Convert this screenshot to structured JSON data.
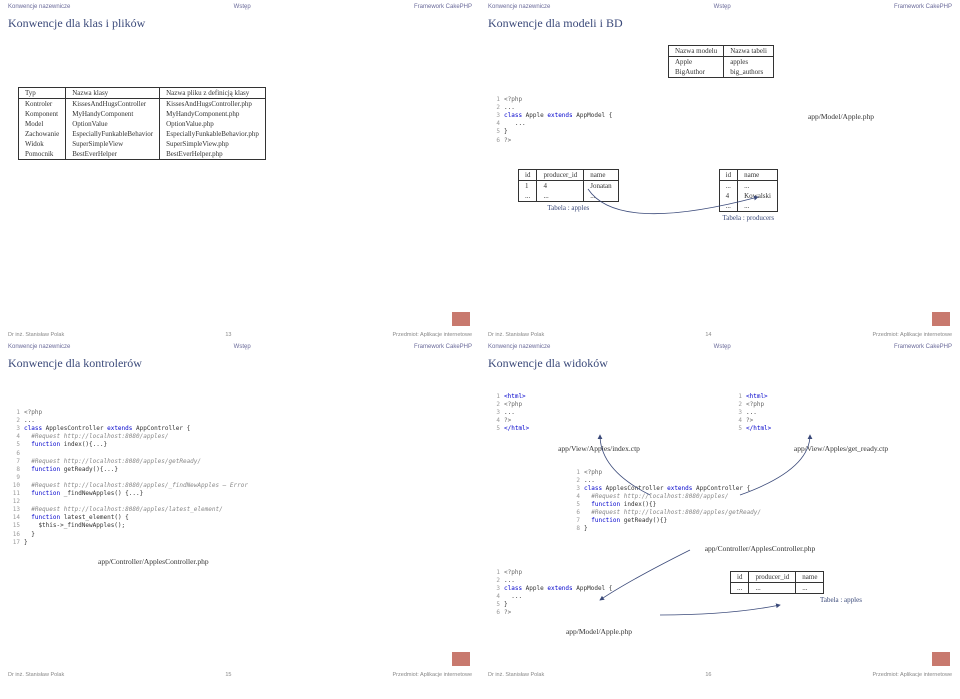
{
  "nav": {
    "left": "Konwencje nazewnicze",
    "mid": "Wstęp",
    "right": "Framework CakePHP"
  },
  "footer": {
    "author": "Dr inż. Stanisław Polak",
    "subject": "Przedmiot: Aplikacje internetowe"
  },
  "slide13": {
    "title": "Konwencje dla klas i plików",
    "num": "13",
    "table": {
      "h1": "Typ",
      "h2": "Nazwa klasy",
      "h3": "Nazwa pliku z definicją klasy",
      "rows": [
        [
          "Kontroler",
          "KissesAndHugsController",
          "KissesAndHugsController.php"
        ],
        [
          "Komponent",
          "MyHandyComponent",
          "MyHandyComponent.php"
        ],
        [
          "Model",
          "OptionValue",
          "OptionValue.php"
        ],
        [
          "Zachowanie",
          "EspeciallyFunkableBehavior",
          "EspeciallyFunkableBehavior.php"
        ],
        [
          "Widok",
          "SuperSimpleView",
          "SuperSimpleView.php"
        ],
        [
          "Pomocnik",
          "BestEverHelper",
          "BestEverHelper.php"
        ]
      ]
    }
  },
  "slide14": {
    "title": "Konwencje dla modeli i BD",
    "num": "14",
    "modelTable": {
      "h1": "Nazwa modelu",
      "h2": "Nazwa tabeli",
      "rows": [
        [
          "Apple",
          "apples"
        ],
        [
          "BigAuthor",
          "big_authors"
        ]
      ]
    },
    "code": [
      "<?php",
      "...",
      "class Apple extends AppModel {",
      "  ...",
      "}",
      "?>"
    ],
    "path": "app/Model/Apple.php",
    "apples": {
      "h": [
        "id",
        "producer_id",
        "name"
      ],
      "rows": [
        [
          "1",
          "4",
          "Jonatan"
        ],
        [
          "...",
          "...",
          "..."
        ]
      ],
      "label": "Tabela : apples"
    },
    "producers": {
      "h": [
        "id",
        "name"
      ],
      "rows": [
        [
          "...",
          "..."
        ],
        [
          "4",
          "Kowalski"
        ],
        [
          "...",
          "..."
        ]
      ],
      "label": "Tabela : producers"
    }
  },
  "slide15": {
    "title": "Konwencje dla kontrolerów",
    "num": "15",
    "code": [
      "<?php",
      "...",
      "class ApplesController extends AppController {",
      "  #Request http://localhost:8080/apples/",
      "  function index(){...}",
      "",
      "  #Request http://localhost:8080/apples/getReady/",
      "  function getReady(){...}",
      "",
      "  #Request http://localhost:8080/apples/_findNewApples — Error",
      "  function _findNewApples() {...}",
      "",
      "  #Request http://localhost:8080/apples/latest_element/",
      "  function latest_element() {",
      "    $this->_findNewApples();",
      "  }",
      "}"
    ],
    "path": "app/Controller/ApplesController.php"
  },
  "slide16": {
    "title": "Konwencje dla widoków",
    "num": "16",
    "view1": [
      "<html>",
      "<?php",
      "...",
      "?>",
      "</html>"
    ],
    "view1path": "app/View/Apples/index.ctp",
    "view2": [
      "<html>",
      "<?php",
      "...",
      "?>",
      "</html>"
    ],
    "view2path": "app/View/Apples/get_ready.ctp",
    "ctrl": [
      "<?php",
      "...",
      "class ApplesController extends AppController {",
      "  #Request http://localhost:8080/apples/",
      "  function index(){}",
      "  #Request http://localhost:8080/apples/getReady/",
      "  function getReady(){}",
      "}"
    ],
    "ctrlpath": "app/Controller/ApplesController.php",
    "model": [
      "<?php",
      "...",
      "class Apple extends AppModel {",
      "  ...",
      "}",
      "?>"
    ],
    "modelpath": "app/Model/Apple.php",
    "table": {
      "h": [
        "id",
        "producer_id",
        "name"
      ],
      "rows": [
        [
          "...",
          "...",
          "..."
        ]
      ],
      "label": "Tabela : apples"
    }
  }
}
